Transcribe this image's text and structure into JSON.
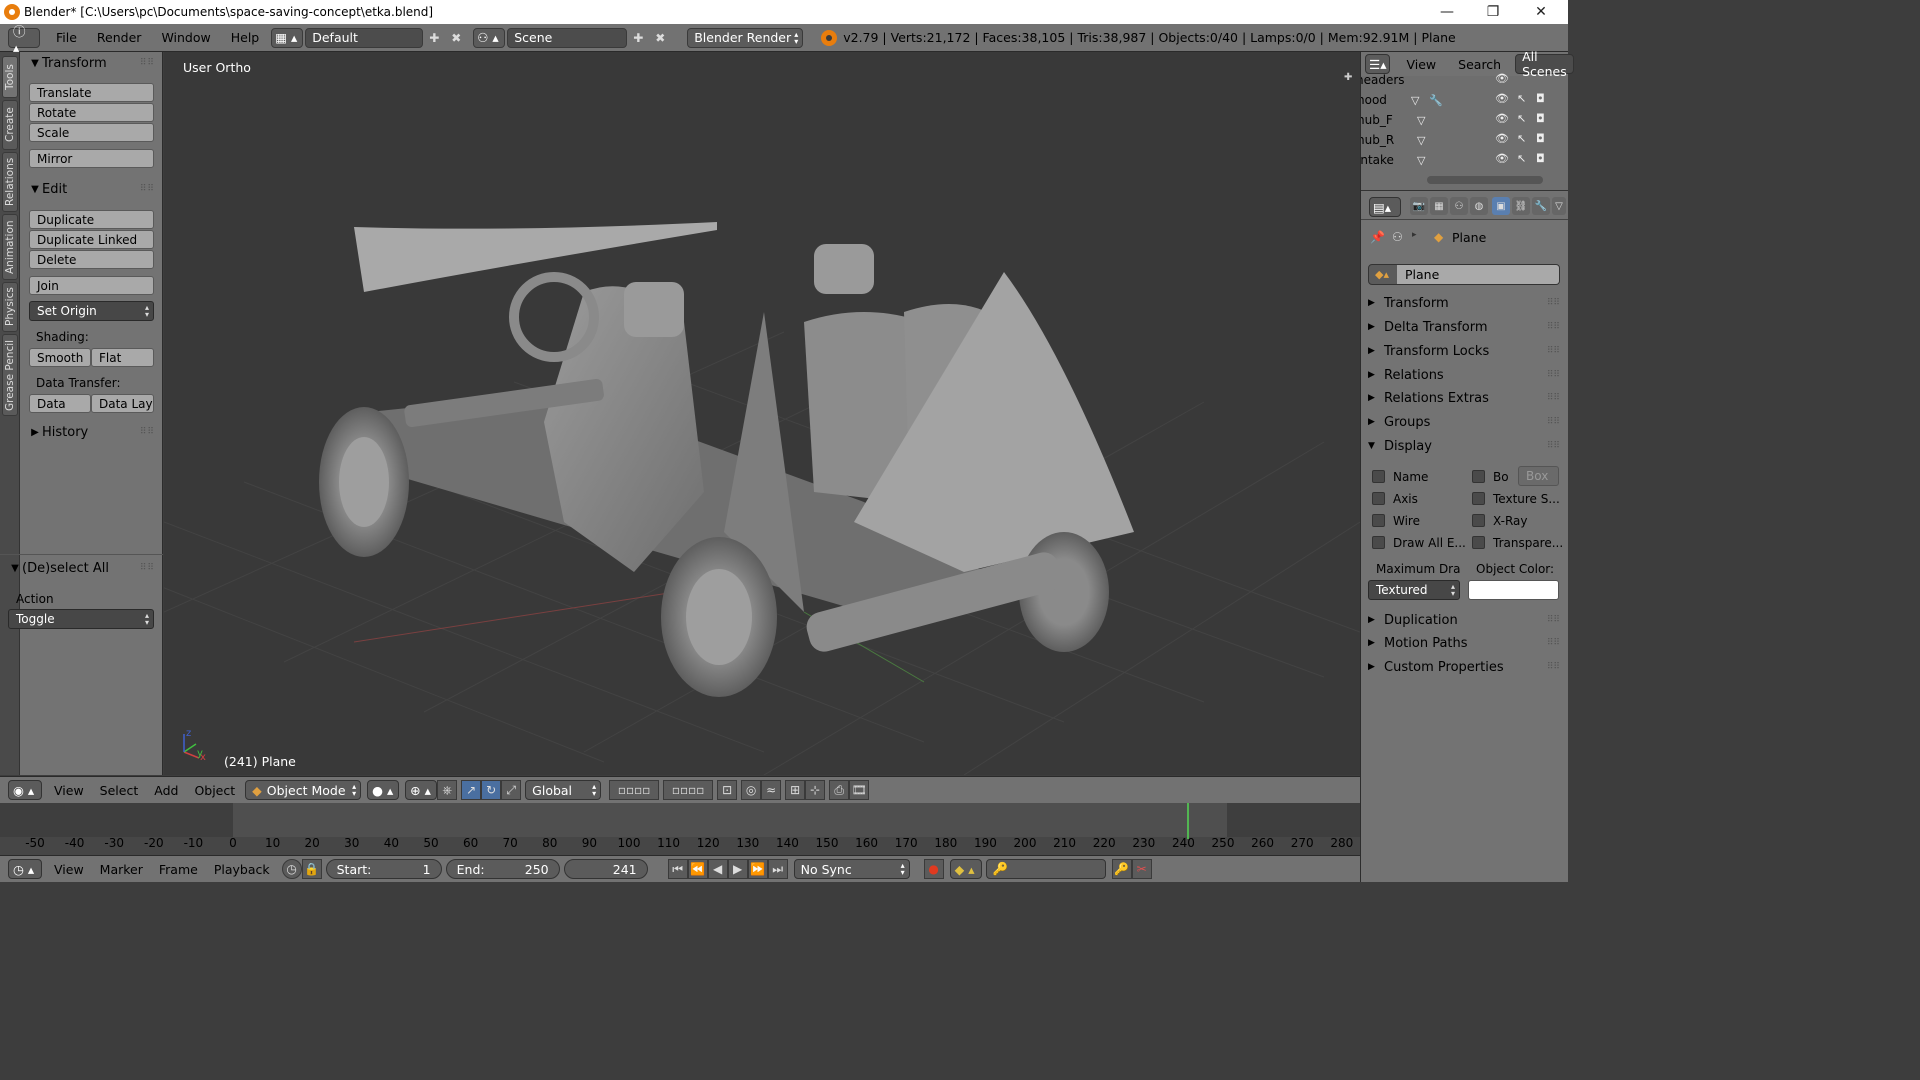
{
  "window": {
    "title": "Blender* [C:\\Users\\pc\\Documents\\space-saving-concept\\etka.blend]",
    "min_glyph": "—",
    "max_glyph": "❐",
    "close_glyph": "✕"
  },
  "info": {
    "menus": [
      "File",
      "Render",
      "Window",
      "Help"
    ],
    "layout": "Default",
    "scene": "Scene",
    "engine": "Blender Render",
    "stats": "v2.79 | Verts:21,172 | Faces:38,105 | Tris:38,987 | Objects:0/40 | Lamps:0/0 | Mem:92.91M | Plane"
  },
  "left_tabs": [
    "Tools",
    "Create",
    "Relations",
    "Animation",
    "Physics",
    "Grease Pencil"
  ],
  "toolshelf": {
    "transform": {
      "title": "Transform",
      "buttons": [
        "Translate",
        "Rotate",
        "Scale",
        "Mirror"
      ]
    },
    "edit": {
      "title": "Edit",
      "buttons": [
        "Duplicate",
        "Duplicate Linked",
        "Delete",
        "Join"
      ],
      "set_origin": "Set Origin"
    },
    "shading": {
      "label": "Shading:",
      "smooth": "Smooth",
      "flat": "Flat"
    },
    "data_transfer": {
      "label": "Data Transfer:",
      "data": "Data",
      "data_lay": "Data Lay"
    },
    "history": "History",
    "operator": {
      "title": "(De)select All",
      "action_label": "Action",
      "action_value": "Toggle"
    }
  },
  "viewport": {
    "view_name": "User Ortho",
    "object_info": "(241) Plane",
    "axis_x": "x",
    "axis_y": "y",
    "axis_z": "z"
  },
  "view_header": {
    "menus": [
      "View",
      "Select",
      "Add",
      "Object"
    ],
    "mode": "Object Mode",
    "orientation": "Global"
  },
  "timeline": {
    "ticks": [
      -50,
      -40,
      -30,
      -20,
      -10,
      0,
      10,
      20,
      30,
      40,
      50,
      60,
      70,
      80,
      90,
      100,
      110,
      120,
      130,
      140,
      150,
      160,
      170,
      180,
      190,
      200,
      210,
      220,
      230,
      240,
      250,
      260,
      270,
      280
    ],
    "current_frame": 241
  },
  "footer": {
    "menus": [
      "View",
      "Marker",
      "Frame",
      "Playback"
    ],
    "start_label": "Start:",
    "start": "1",
    "end_label": "End:",
    "end": "250",
    "current": "241",
    "sync": "No Sync"
  },
  "outliner": {
    "menus": [
      "View",
      "Search"
    ],
    "scope": "All Scenes",
    "rows": [
      "headers",
      "hood",
      "hub_F",
      "hub_R",
      "intake"
    ]
  },
  "properties": {
    "breadcrumb": "Plane",
    "object_name": "Plane",
    "panels": [
      "Transform",
      "Delta Transform",
      "Transform Locks",
      "Relations",
      "Relations Extras",
      "Groups"
    ],
    "display": {
      "title": "Display",
      "left": [
        "Name",
        "Axis",
        "Wire",
        "Draw All E..."
      ],
      "right": [
        "Bo",
        "Texture S...",
        "X-Ray",
        "Transpare..."
      ],
      "box": "Box",
      "max_draw_label": "Maximum Dra",
      "object_color_label": "Object Color:",
      "max_draw_value": "Textured",
      "object_color": "#ffffff"
    },
    "panels_after": [
      "Duplication",
      "Motion Paths",
      "Custom Properties"
    ]
  }
}
